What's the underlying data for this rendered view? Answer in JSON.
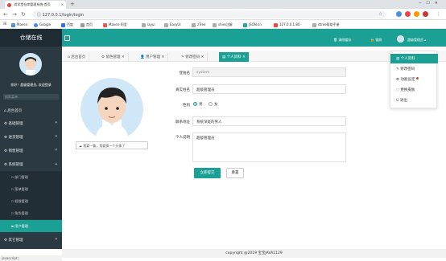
{
  "browser": {
    "tab_title": "尚学堂仓库管理系统-首页",
    "url": "127.0.0.1/login/login",
    "bookmarks": [
      "Maven",
      "Google",
      "百度",
      "首页",
      "Maven-阿里",
      "layui",
      "EasyUI",
      "zTree",
      "shiro注解",
      "JSON.cn",
      "127.0.0.1:80",
      "dtree帮助手册"
    ]
  },
  "app": {
    "logo": "仓储在线",
    "header": {
      "clear_cache": "清除缓存",
      "lock": "锁屏",
      "user": "超级管理员"
    }
  },
  "sidebar": {
    "greeting": "你好！超级管理员, 欢迎登录",
    "search_placeholder": "搜索菜单",
    "items": [
      {
        "label": "后台首页"
      },
      {
        "label": "基础管理"
      },
      {
        "label": "进货管理"
      },
      {
        "label": "销售管理"
      },
      {
        "label": "系统管理"
      }
    ],
    "subitems": [
      {
        "label": "部门管理"
      },
      {
        "label": "菜单管理"
      },
      {
        "label": "权限管理"
      },
      {
        "label": "角色管理"
      },
      {
        "label": "用户管理"
      }
    ],
    "last_item": "其它管理"
  },
  "tabs": [
    {
      "label": "后台首页"
    },
    {
      "label": "角色管理"
    },
    {
      "label": "用户管理"
    },
    {
      "label": "修改密码"
    },
    {
      "label": "个人资料"
    }
  ],
  "profile": {
    "avatar_button": "我要一瞥，我要换一个头像了",
    "login_name_label": "登陆名",
    "login_name": "system",
    "real_name_label": "真实姓名",
    "real_name": "超级管理员",
    "gender_label": "性别",
    "gender_male": "男",
    "gender_female": "女",
    "address_label": "联系地址",
    "address": "系统深处的男人",
    "remark_label": "个人说明",
    "remark": "超级管理员",
    "submit": "立即提交",
    "reset": "重置"
  },
  "dropdown": {
    "items": [
      {
        "label": "个人资料"
      },
      {
        "label": "修改密码"
      },
      {
        "label": "功能设定"
      },
      {
        "label": "更换皮肤"
      },
      {
        "label": "退出"
      }
    ]
  },
  "footer": "copyright @2019 宝宝JAVA1129",
  "status": "javascript:;",
  "colors": {
    "accent": "#1aa094",
    "sidebar": "#2b3a42",
    "logo_bg": "#1e2b33"
  }
}
